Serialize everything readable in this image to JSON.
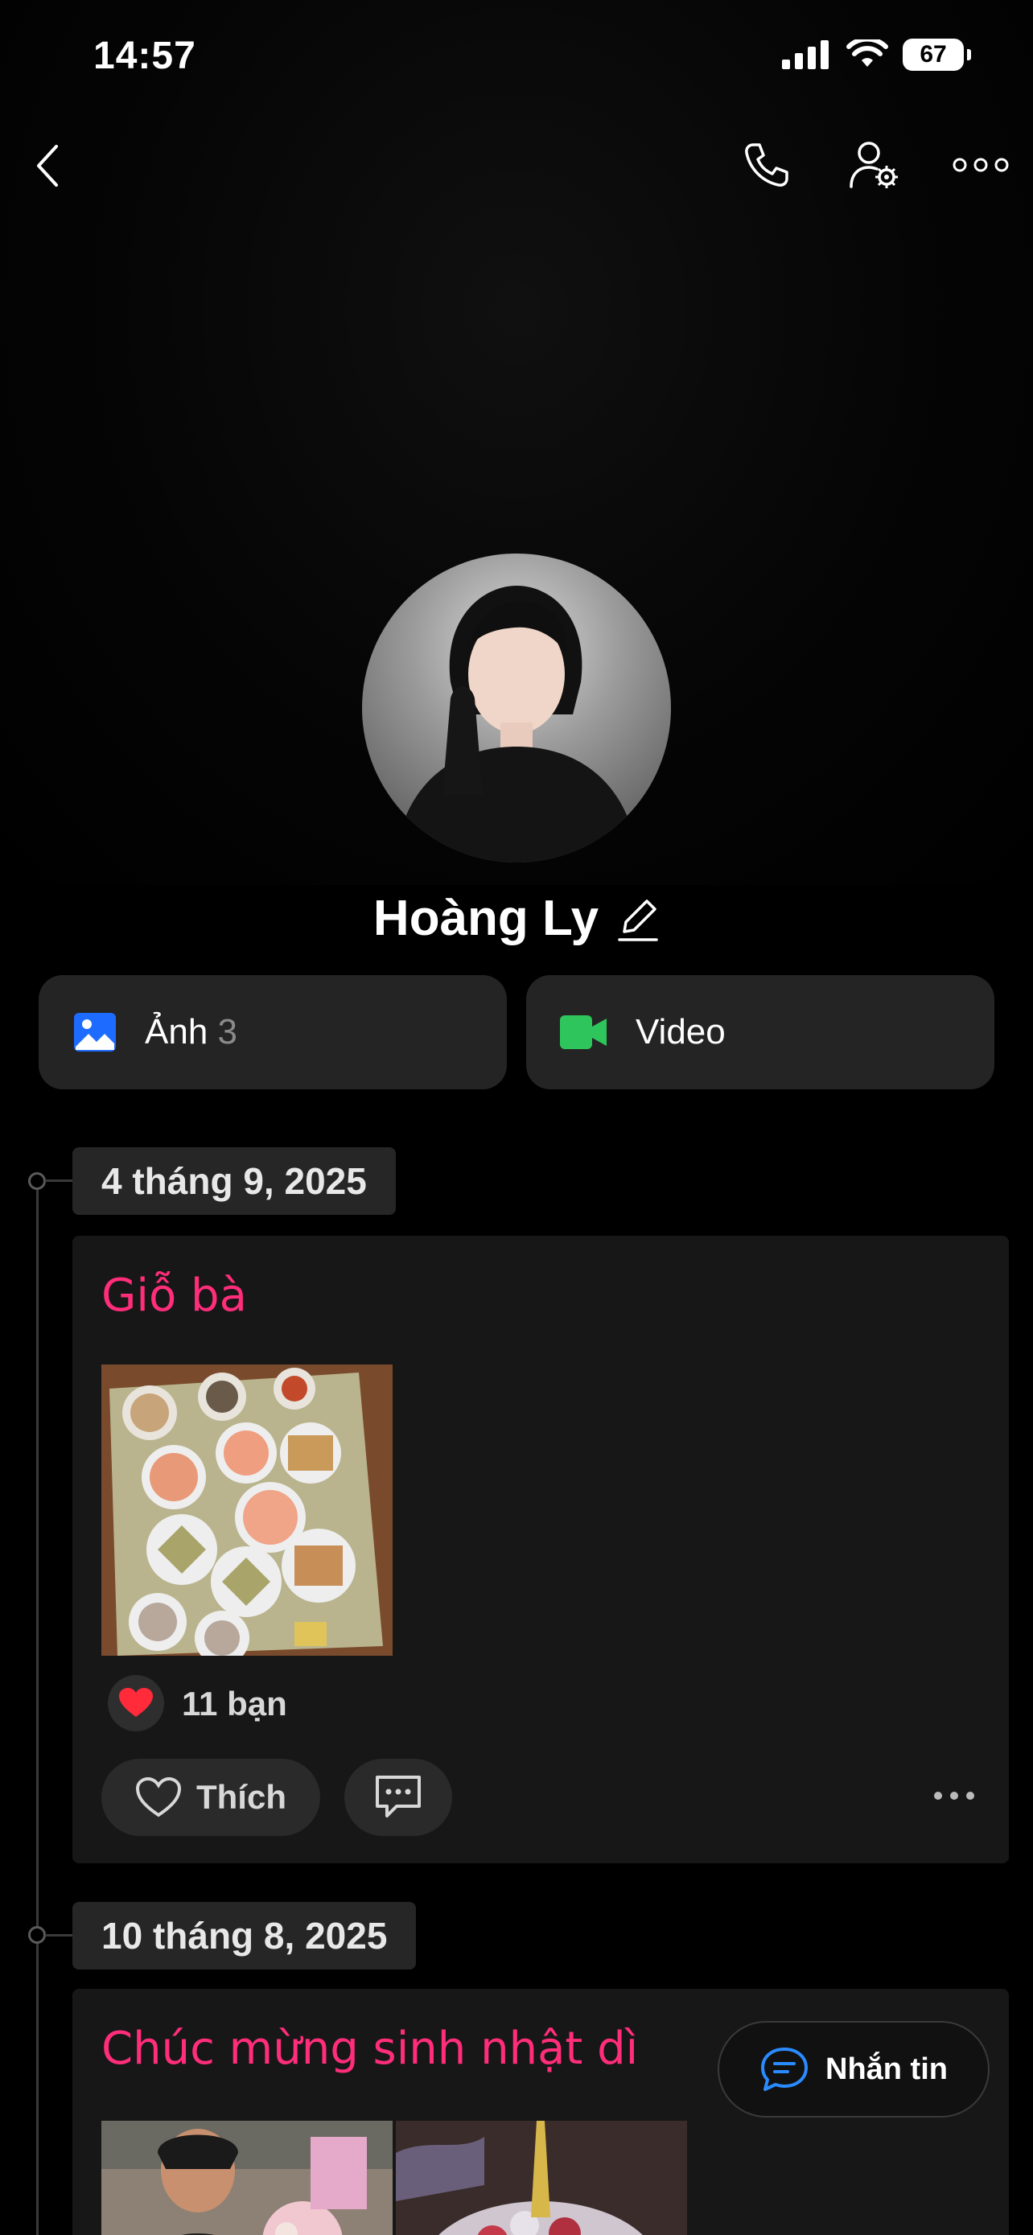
{
  "status_bar": {
    "time": "14:57",
    "battery": "67"
  },
  "header": {
    "back_icon": "chevron-left-icon",
    "call_icon": "phone-icon",
    "settings_icon": "user-settings-icon",
    "more_icon": "more-horizontal-icon"
  },
  "profile": {
    "name": "Hoàng Ly"
  },
  "media": {
    "photos_label": "Ảnh",
    "photos_count": "3",
    "video_label": "Video",
    "photos_color": "#1e6cff",
    "video_color": "#2ec65c"
  },
  "posts": [
    {
      "date": "4 tháng 9, 2025",
      "title": "Giỗ bà",
      "reactions": "11 bạn",
      "like_label": "Thích"
    },
    {
      "date": "10 tháng 8, 2025",
      "title": "Chúc mừng sinh nhật dì"
    }
  ],
  "message_button": {
    "label": "Nhắn tin"
  },
  "colors": {
    "accent_pink": "#ff2d7a",
    "bg": "#000000",
    "card": "#171717"
  }
}
